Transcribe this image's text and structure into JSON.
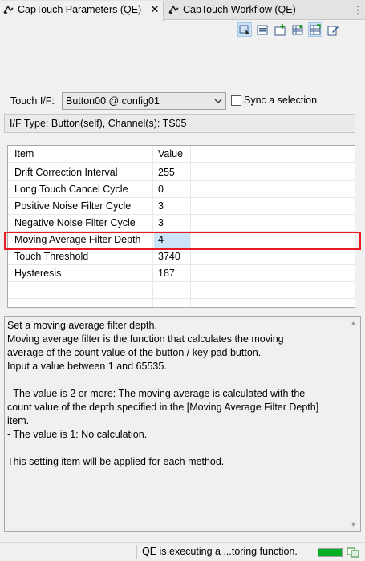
{
  "tabs": [
    {
      "label": "CapTouch Parameters (QE)",
      "close": "✕"
    },
    {
      "label": "CapTouch Workflow (QE)"
    }
  ],
  "toolbar": {
    "icons": [
      "select-icon",
      "list-icon",
      "add-config-icon",
      "config-table-icon",
      "tuning-icon",
      "write-icon"
    ]
  },
  "touch_if": {
    "label": "Touch I/F:",
    "selected": "Button00 @ config01",
    "sync_label": "Sync a selection",
    "sync_checked": false
  },
  "if_type": "I/F Type: Button(self), Channel(s): TS05",
  "table": {
    "columns": [
      "Item",
      "Value"
    ],
    "rows": [
      {
        "item": "Drift Correction Interval",
        "value": "255"
      },
      {
        "item": "Long Touch Cancel Cycle",
        "value": "0"
      },
      {
        "item": "Positive Noise Filter Cycle",
        "value": "3"
      },
      {
        "item": "Negative Noise Filter Cycle",
        "value": "3"
      },
      {
        "item": "Moving Average Filter Depth",
        "value": "4"
      },
      {
        "item": "Touch Threshold",
        "value": "3740"
      },
      {
        "item": "Hysteresis",
        "value": "187"
      }
    ],
    "selected_row": "Moving Average Filter Depth"
  },
  "description": {
    "lines": [
      "Set a moving average filter depth.",
      "Moving average filter is the function that calculates the moving",
      "average of the count value of the button / key pad button.",
      "Input a value between 1 and 65535.",
      "",
      "- The value is 2 or more: The moving average is calculated with the",
      "count value of the depth specified in the [Moving Average Filter Depth]",
      "item.",
      " - The value is 1: No calculation.",
      "",
      "This setting item will be applied for each method."
    ]
  },
  "status": {
    "text": "QE is executing a ...toring function.",
    "progress": 1.0,
    "progress_color": "#06b025"
  },
  "colors": {
    "highlight_border": "#e81b23",
    "selection": "#cce4f7"
  }
}
